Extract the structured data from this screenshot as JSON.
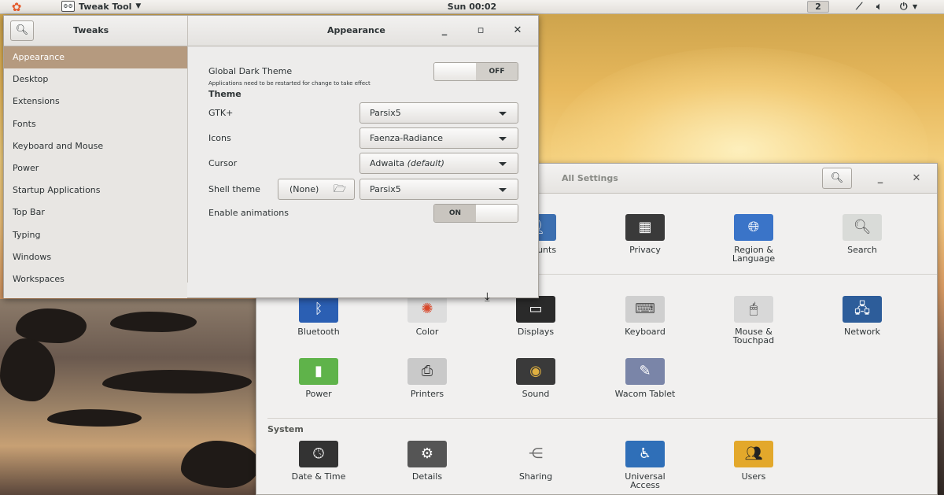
{
  "topbar": {
    "app_name": "Tweak Tool",
    "clock": "Sun 00:02",
    "workspace": "2",
    "tray": {
      "network_icon": "network-icon",
      "volume_icon": "volume-icon",
      "power_icon": "power-icon"
    }
  },
  "tweaks": {
    "sidebar_title": "Tweaks",
    "page_title": "Appearance",
    "sidebar_items": [
      "Appearance",
      "Desktop",
      "Extensions",
      "Fonts",
      "Keyboard and Mouse",
      "Power",
      "Startup Applications",
      "Top Bar",
      "Typing",
      "Windows",
      "Workspaces"
    ],
    "global_dark_theme": {
      "label": "Global Dark Theme",
      "note": "Applications need to be restarted for change to take effect",
      "state": "OFF"
    },
    "theme_section": "Theme",
    "gtk": {
      "label": "GTK+",
      "value": "Parsix5"
    },
    "icons": {
      "label": "Icons",
      "value": "Faenza-Radiance"
    },
    "cursor": {
      "label": "Cursor",
      "value": "Adwaita",
      "value_suffix": "(default)"
    },
    "shell_theme": {
      "label": "Shell theme",
      "none_label": "(None)",
      "value": "Parsix5"
    },
    "animations": {
      "label": "Enable animations",
      "state": "ON"
    }
  },
  "settings": {
    "title": "All Settings",
    "personal": [
      {
        "label": "Accounts",
        "icon": "accounts-icon"
      },
      {
        "label": "Privacy",
        "icon": "privacy-icon"
      },
      {
        "label": "Region & Language",
        "icon": "region-icon"
      },
      {
        "label": "Search",
        "icon": "search-icon"
      }
    ],
    "hardware": [
      {
        "label": "Bluetooth",
        "icon": "bluetooth-icon"
      },
      {
        "label": "Color",
        "icon": "color-icon"
      },
      {
        "label": "Displays",
        "icon": "displays-icon"
      },
      {
        "label": "Keyboard",
        "icon": "keyboard-icon"
      },
      {
        "label": "Mouse & Touchpad",
        "icon": "mouse-icon"
      },
      {
        "label": "Network",
        "icon": "network-icon"
      },
      {
        "label": "Power",
        "icon": "battery-icon"
      },
      {
        "label": "Printers",
        "icon": "printer-icon"
      },
      {
        "label": "Sound",
        "icon": "speaker-icon"
      },
      {
        "label": "Wacom Tablet",
        "icon": "tablet-icon"
      }
    ],
    "system_section": "System",
    "system": [
      {
        "label": "Date & Time",
        "icon": "clock-icon"
      },
      {
        "label": "Details",
        "icon": "gears-icon"
      },
      {
        "label": "Sharing",
        "icon": "share-icon"
      },
      {
        "label": "Universal Access",
        "icon": "accessibility-icon"
      },
      {
        "label": "Users",
        "icon": "users-icon"
      }
    ]
  }
}
